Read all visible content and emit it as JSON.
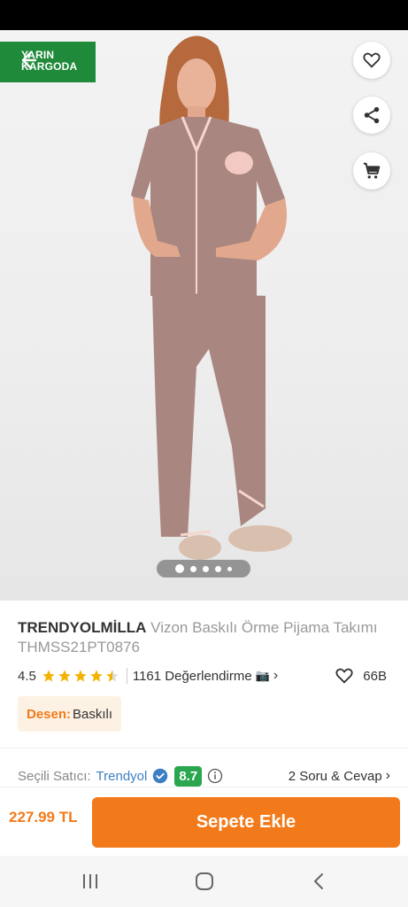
{
  "hero": {
    "badge_line1": "YARIN",
    "badge_line2": "KARGODA",
    "carousel_dots": 5,
    "carousel_active": 0
  },
  "product": {
    "brand": "TRENDYOLMİLLA",
    "name": "Vizon Baskılı Örme Pijama Takımı THMSS21PT0876",
    "rating": "4.5",
    "rating_value": 4.5,
    "reviews": "1161 Değerlendirme",
    "favorites": "66B",
    "pattern_key": "Desen:",
    "pattern_value": "Baskılı"
  },
  "seller": {
    "label": "Seçili Satıcı:",
    "name": "Trendyol",
    "score": "8.7",
    "qa": "2 Soru & Cevap"
  },
  "cart": {
    "price": "227.99 TL",
    "add_label": "Sepete Ekle"
  },
  "colors": {
    "accent": "#f27a1a",
    "badge_green": "#1f8a3a",
    "score_green": "#2aa64f",
    "star": "#f5b301",
    "seller_blue": "#3d7fc4"
  },
  "icons": [
    "back-arrow-icon",
    "heart-icon",
    "share-icon",
    "cart-icon",
    "star-icon",
    "camera-icon",
    "chevron-right-icon",
    "verified-icon",
    "info-icon",
    "recents-icon",
    "home-icon",
    "back-icon"
  ]
}
